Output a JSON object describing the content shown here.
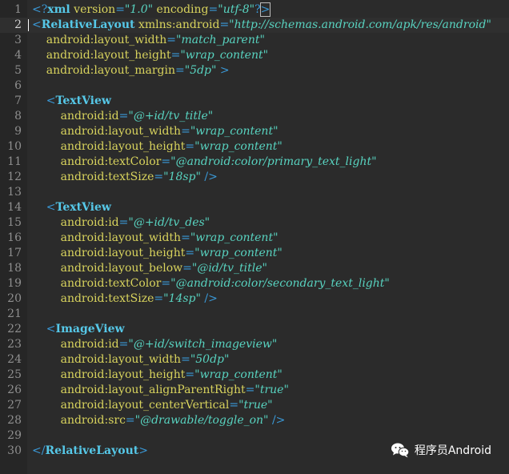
{
  "editor": {
    "active_line": 2,
    "colors": {
      "background": "#2b2b2b",
      "line_numbers": "#8f8f8f",
      "punctuation": "#3a9ad9",
      "tag": "#56c8e8",
      "attribute": "#d8d35d",
      "value": "#58d3c0"
    },
    "lines": [
      {
        "n": "1",
        "tokens": [
          [
            "punct",
            "<?"
          ],
          [
            "tag",
            "xml"
          ],
          [
            "attr",
            " version"
          ],
          [
            "punct",
            "="
          ],
          [
            "val",
            "\"1.0\""
          ],
          [
            "attr",
            " encoding"
          ],
          [
            "punct",
            "="
          ],
          [
            "val",
            "\"utf-8\""
          ],
          [
            "punct",
            "?"
          ],
          [
            "box",
            ">"
          ]
        ]
      },
      {
        "n": "2",
        "tokens": [
          [
            "punct",
            "<"
          ],
          [
            "tag",
            "RelativeLayout"
          ],
          [
            "attr",
            " xmlns:android"
          ],
          [
            "punct",
            "="
          ],
          [
            "val",
            "\"http://schemas.android.com/apk/res/android\""
          ]
        ]
      },
      {
        "n": "3",
        "tokens": [
          [
            "attr",
            "    android:layout_width"
          ],
          [
            "punct",
            "="
          ],
          [
            "val",
            "\"match_parent\""
          ]
        ]
      },
      {
        "n": "4",
        "tokens": [
          [
            "attr",
            "    android:layout_height"
          ],
          [
            "punct",
            "="
          ],
          [
            "val",
            "\"wrap_content\""
          ]
        ]
      },
      {
        "n": "5",
        "tokens": [
          [
            "attr",
            "    android:layout_margin"
          ],
          [
            "punct",
            "="
          ],
          [
            "val",
            "\"5dp\""
          ],
          [
            "punct",
            " >"
          ]
        ]
      },
      {
        "n": "6",
        "tokens": []
      },
      {
        "n": "7",
        "tokens": [
          [
            "punct",
            "    <"
          ],
          [
            "tag",
            "TextView"
          ]
        ]
      },
      {
        "n": "8",
        "tokens": [
          [
            "attr",
            "        android:id"
          ],
          [
            "punct",
            "="
          ],
          [
            "val",
            "\"@+id/tv_title\""
          ]
        ]
      },
      {
        "n": "9",
        "tokens": [
          [
            "attr",
            "        android:layout_width"
          ],
          [
            "punct",
            "="
          ],
          [
            "val",
            "\"wrap_content\""
          ]
        ]
      },
      {
        "n": "10",
        "tokens": [
          [
            "attr",
            "        android:layout_height"
          ],
          [
            "punct",
            "="
          ],
          [
            "val",
            "\"wrap_content\""
          ]
        ]
      },
      {
        "n": "11",
        "tokens": [
          [
            "attr",
            "        android:textColor"
          ],
          [
            "punct",
            "="
          ],
          [
            "val",
            "\"@android:color/primary_text_light\""
          ]
        ]
      },
      {
        "n": "12",
        "tokens": [
          [
            "attr",
            "        android:textSize"
          ],
          [
            "punct",
            "="
          ],
          [
            "val",
            "\"18sp\""
          ],
          [
            "punct",
            " />"
          ]
        ]
      },
      {
        "n": "13",
        "tokens": []
      },
      {
        "n": "14",
        "tokens": [
          [
            "punct",
            "    <"
          ],
          [
            "tag",
            "TextView"
          ]
        ]
      },
      {
        "n": "15",
        "tokens": [
          [
            "attr",
            "        android:id"
          ],
          [
            "punct",
            "="
          ],
          [
            "val",
            "\"@+id/tv_des\""
          ]
        ]
      },
      {
        "n": "16",
        "tokens": [
          [
            "attr",
            "        android:layout_width"
          ],
          [
            "punct",
            "="
          ],
          [
            "val",
            "\"wrap_content\""
          ]
        ]
      },
      {
        "n": "17",
        "tokens": [
          [
            "attr",
            "        android:layout_height"
          ],
          [
            "punct",
            "="
          ],
          [
            "val",
            "\"wrap_content\""
          ]
        ]
      },
      {
        "n": "18",
        "tokens": [
          [
            "attr",
            "        android:layout_below"
          ],
          [
            "punct",
            "="
          ],
          [
            "val",
            "\"@id/tv_title\""
          ]
        ]
      },
      {
        "n": "19",
        "tokens": [
          [
            "attr",
            "        android:textColor"
          ],
          [
            "punct",
            "="
          ],
          [
            "val",
            "\"@android:color/secondary_text_light\""
          ]
        ]
      },
      {
        "n": "20",
        "tokens": [
          [
            "attr",
            "        android:textSize"
          ],
          [
            "punct",
            "="
          ],
          [
            "val",
            "\"14sp\""
          ],
          [
            "punct",
            " />"
          ]
        ]
      },
      {
        "n": "21",
        "tokens": []
      },
      {
        "n": "22",
        "tokens": [
          [
            "punct",
            "    <"
          ],
          [
            "tag",
            "ImageView"
          ]
        ]
      },
      {
        "n": "23",
        "tokens": [
          [
            "attr",
            "        android:id"
          ],
          [
            "punct",
            "="
          ],
          [
            "val",
            "\"@+id/switch_imageview\""
          ]
        ]
      },
      {
        "n": "24",
        "tokens": [
          [
            "attr",
            "        android:layout_width"
          ],
          [
            "punct",
            "="
          ],
          [
            "val",
            "\"50dp\""
          ]
        ]
      },
      {
        "n": "25",
        "tokens": [
          [
            "attr",
            "        android:layout_height"
          ],
          [
            "punct",
            "="
          ],
          [
            "val",
            "\"wrap_content\""
          ]
        ]
      },
      {
        "n": "26",
        "tokens": [
          [
            "attr",
            "        android:layout_alignParentRight"
          ],
          [
            "punct",
            "="
          ],
          [
            "val",
            "\"true\""
          ]
        ]
      },
      {
        "n": "27",
        "tokens": [
          [
            "attr",
            "        android:layout_centerVertical"
          ],
          [
            "punct",
            "="
          ],
          [
            "val",
            "\"true\""
          ]
        ]
      },
      {
        "n": "28",
        "tokens": [
          [
            "attr",
            "        android:src"
          ],
          [
            "punct",
            "="
          ],
          [
            "val",
            "\"@drawable/toggle_on\""
          ],
          [
            "punct",
            " />"
          ]
        ]
      },
      {
        "n": "29",
        "tokens": []
      },
      {
        "n": "30",
        "tokens": [
          [
            "punct",
            "</"
          ],
          [
            "tag",
            "RelativeLayout"
          ],
          [
            "punct",
            ">"
          ]
        ]
      }
    ]
  },
  "watermark": {
    "icon": "wechat-icon",
    "text": "程序员Android"
  }
}
